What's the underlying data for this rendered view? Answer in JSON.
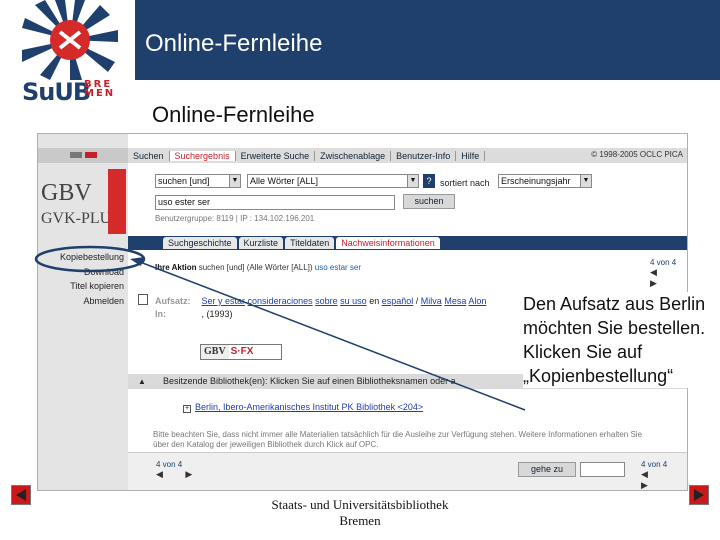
{
  "banner": {
    "title": "Online-Fernleihe",
    "logo_text": "SuUB",
    "logo_bremen": "BRE MEN"
  },
  "slide_title": "Online-Fernleihe",
  "screenshot": {
    "top_nav": [
      "Suchen",
      "Suchergebnis",
      "Erweiterte Suche",
      "Zwischenablage",
      "Benutzer-Info",
      "Hilfe"
    ],
    "copyright": "© 1998-2005 OCLC PICA",
    "brand1": "GBV",
    "brand2": "GVK-PLUS!",
    "search_mode": "suchen [und]",
    "search_field": "Alle Wörter [ALL]",
    "help": "?",
    "sort_label": "sortiert nach",
    "sort_value": "Erscheinungsjahr",
    "query": "uso ester ser",
    "search_button": "suchen",
    "user_group": "Benutzergruppe: 8119 | IP : 134.102.196.201",
    "tabs": [
      "Suchgeschichte",
      "Kurzliste",
      "Titeldaten",
      "Nachweisinformationen"
    ],
    "menu": [
      "Kopiebestellung",
      "Download",
      "Titel kopieren",
      "Abmelden"
    ],
    "action_label": "Ihre Aktion",
    "action_text": "suchen [und] (Alle Wörter [ALL])",
    "action_query": "uso estar ser",
    "pager": "4 von 4",
    "pager_arrows": "◀ ▶",
    "aufsatz_label": "Aufsatz:",
    "aufsatz_links": [
      "Ser y estar",
      "consideraciones",
      "sobre",
      "su uso",
      "en",
      "español",
      "/",
      "Milva",
      "Mesa",
      "Alon"
    ],
    "in_label": "In:",
    "in_value": ", (1993)",
    "gbv_sfx_gbv": "GBV",
    "gbv_sfx_sfx": "S·FX",
    "bib_header": "Besitzende Bibliothek(en): Klicken Sie auf einen Bibliotheksnamen oder a",
    "bib_plus": "+",
    "bib_line": "Berlin, Ibero-Amerikanisches Institut PK Bibliothek <204>",
    "note": "Bitte beachten Sie, dass nicht immer alle Materialien tatsächlich für die Ausleihe zur Verfügung stehen. Weitere Informationen erhalten Sie über den Katalog der jeweiligen Bibliothek durch Klick auf OPC.",
    "goto_button": "gehe zu"
  },
  "annotation": "Den Aufsatz aus Berlin möchten Sie bestellen. Klicken Sie auf „Kopienbestellung“",
  "footer": {
    "line1": "Staats- und Universitätsbibliothek",
    "line2": "Bremen"
  },
  "colors": {
    "banner": "#1f3f6c",
    "accent_red": "#c8202a",
    "nav_button": "#cc1818"
  },
  "icons": {
    "prev": "arrow-left-icon",
    "next": "arrow-right-icon"
  }
}
